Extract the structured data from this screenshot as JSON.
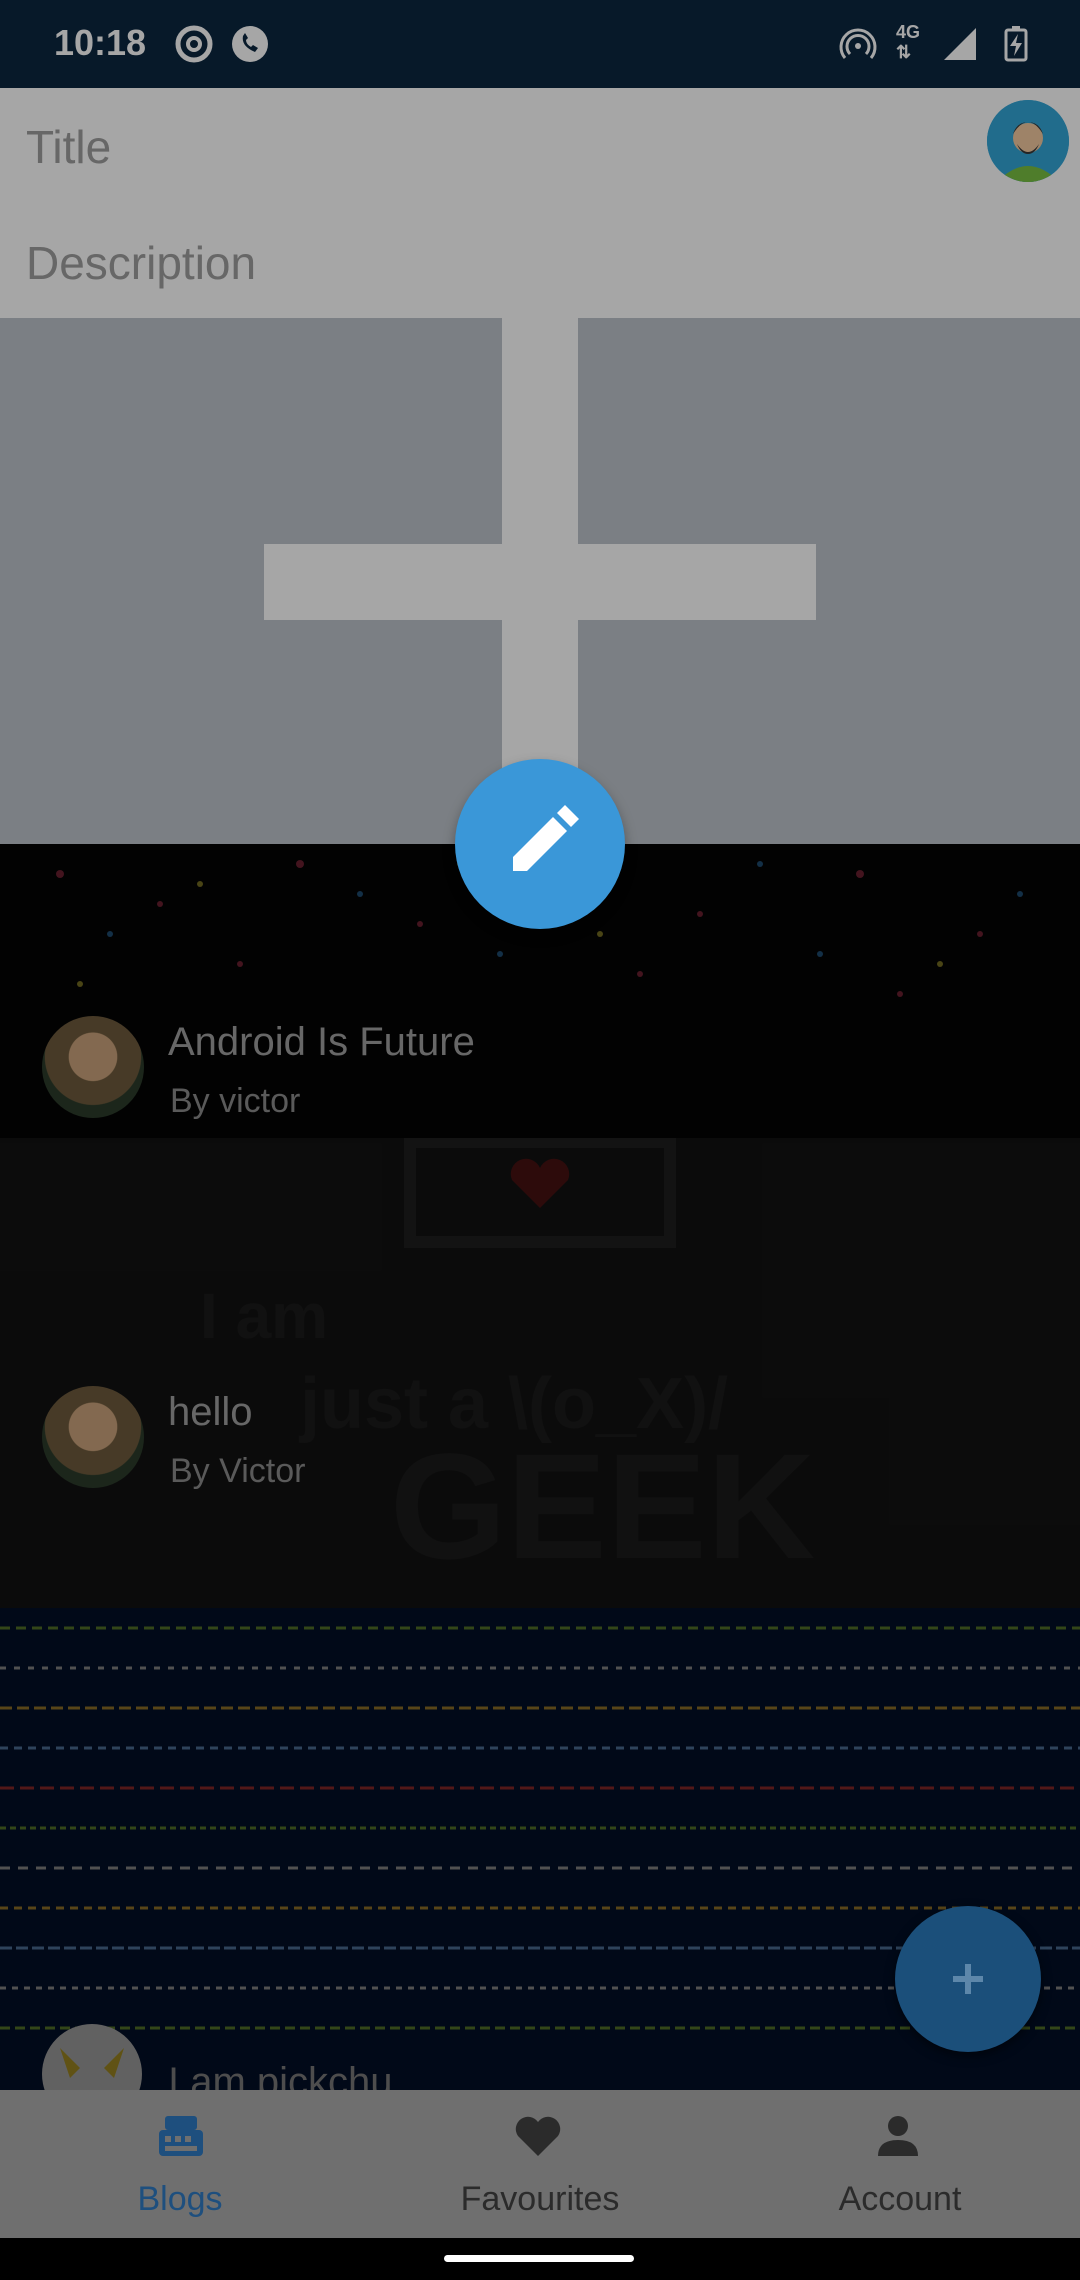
{
  "status_bar": {
    "time": "10:18",
    "network": "4G",
    "icons": [
      "at-sign-icon",
      "phone-icon",
      "hotspot-icon",
      "signal-icon",
      "battery-charging-icon"
    ]
  },
  "composer": {
    "title_placeholder": "Title",
    "description_placeholder": "Description",
    "add_image_icon": "plus-icon"
  },
  "fab_edit_icon": "pencil-icon",
  "feed": {
    "posts": [
      {
        "title": "Android Is Future",
        "author": "By victor"
      },
      {
        "title": "hello",
        "author": "By Victor"
      },
      {
        "title": "I am pickchu",
        "author": ""
      }
    ],
    "card2_art_text": [
      "I am",
      "just a \\(o_X)/",
      "GEEK"
    ]
  },
  "fab_add_icon": "plus-icon",
  "bottom_nav": {
    "items": [
      {
        "label": "Blogs",
        "icon": "blog-icon",
        "active": true
      },
      {
        "label": "Favourites",
        "icon": "heart-icon",
        "active": false
      },
      {
        "label": "Account",
        "icon": "person-icon",
        "active": false
      }
    ]
  },
  "colors": {
    "status_bar": "#0b2740",
    "accent": "#3a97d8",
    "nav_background": "#6f6f6f",
    "nav_active": "#1e4f7e"
  }
}
